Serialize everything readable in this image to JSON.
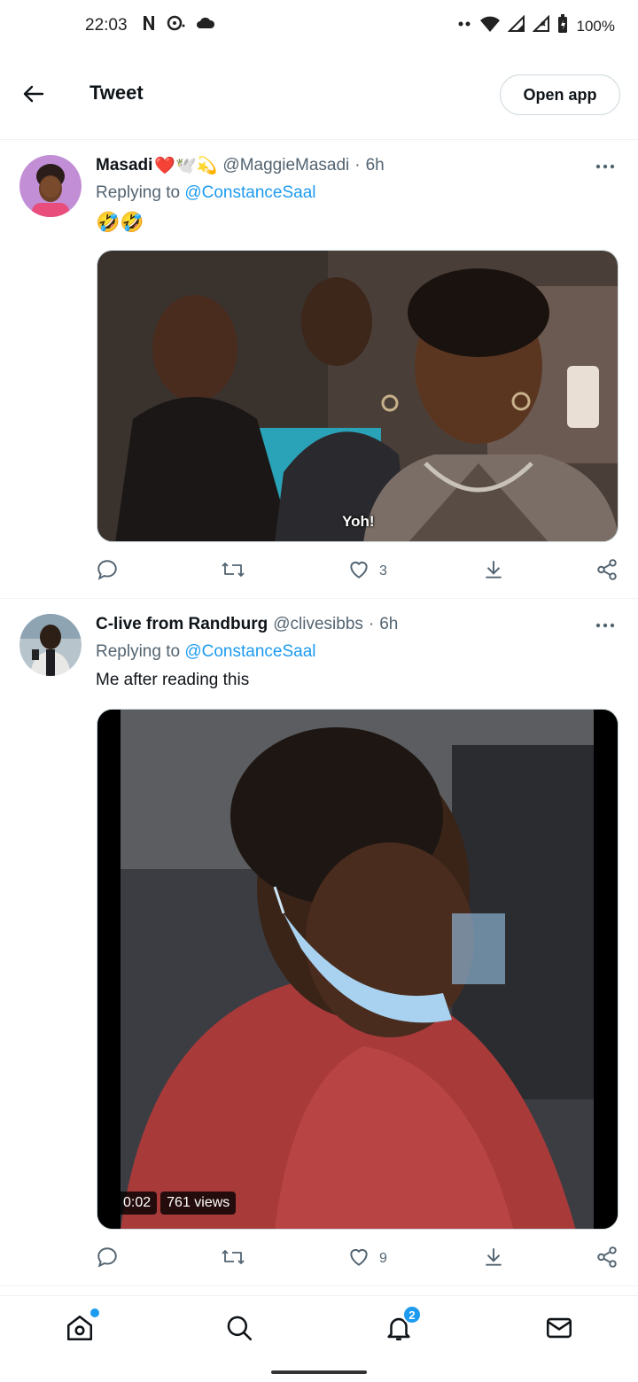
{
  "status_bar": {
    "time": "22:03",
    "battery": "100%",
    "icons": [
      "netflix-n-icon",
      "pokeball-icon",
      "cloud-icon",
      "dots-icon",
      "wifi-icon",
      "signal-icon",
      "signal-x-icon",
      "battery-icon"
    ]
  },
  "header": {
    "title": "Tweet",
    "open_app_label": "Open app"
  },
  "tweets": [
    {
      "display_name": "Masadi",
      "name_emojis": "❤️🕊️💫",
      "handle": "@MaggieMasadi",
      "time": "6h",
      "replying_to_prefix": "Replying to ",
      "replying_to_mention": "@ConstanceSaal",
      "text": "🤣🤣",
      "media": {
        "type": "image",
        "caption": "Yoh!"
      },
      "likes": "3"
    },
    {
      "display_name": "C-live from Randburg",
      "name_emojis": "",
      "handle": "@clivesibbs",
      "time": "6h",
      "replying_to_prefix": "Replying to ",
      "replying_to_mention": "@ConstanceSaal",
      "text": "Me after reading this",
      "media": {
        "type": "video",
        "duration": "0:02",
        "views": "761 views"
      },
      "likes": "9"
    }
  ],
  "bottom_nav": {
    "notifications_badge": "2"
  },
  "colors": {
    "accent": "#1d9bf0",
    "text_primary": "#0f1419",
    "text_secondary": "#536471",
    "border": "#eff3f4"
  }
}
